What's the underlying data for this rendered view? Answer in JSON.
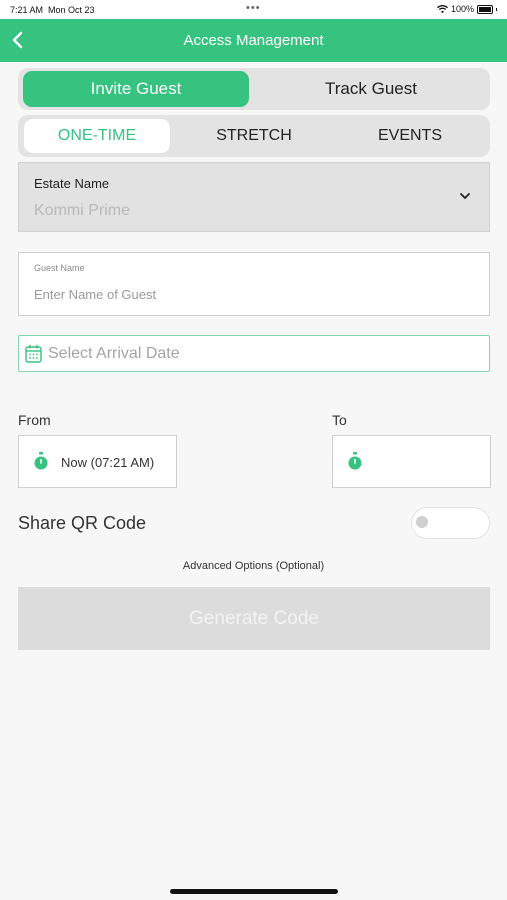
{
  "status_bar": {
    "time": "7:21 AM",
    "date": "Mon Oct 23",
    "dots": "•••",
    "battery": "100%"
  },
  "header": {
    "title": "Access Management",
    "back_icon": "chevron-left-icon"
  },
  "tabs_primary": [
    {
      "label": "Invite Guest",
      "selected": true
    },
    {
      "label": "Track Guest",
      "selected": false
    }
  ],
  "tabs_secondary": [
    {
      "label": "ONE-TIME",
      "selected": true
    },
    {
      "label": "STRETCH",
      "selected": false
    },
    {
      "label": "EVENTS",
      "selected": false
    }
  ],
  "estate": {
    "label": "Estate Name",
    "value": "Kommi Prime",
    "icon": "chevron-down-icon"
  },
  "guest": {
    "label": "Guest Name",
    "placeholder": "Enter Name of Guest",
    "value": ""
  },
  "arrival": {
    "placeholder": "Select Arrival Date",
    "icon": "calendar-icon"
  },
  "time": {
    "from_label": "From",
    "to_label": "To",
    "from_value": "Now (07:21 AM)",
    "to_value": "",
    "icon": "stopwatch-icon"
  },
  "share": {
    "label": "Share QR Code",
    "enabled": false
  },
  "advanced_options": "Advanced Options (Optional)",
  "generate_button": "Generate Code",
  "colors": {
    "accent": "#36c27f",
    "disabled_button": "#dcdcdc",
    "background": "#f7f7f7"
  }
}
